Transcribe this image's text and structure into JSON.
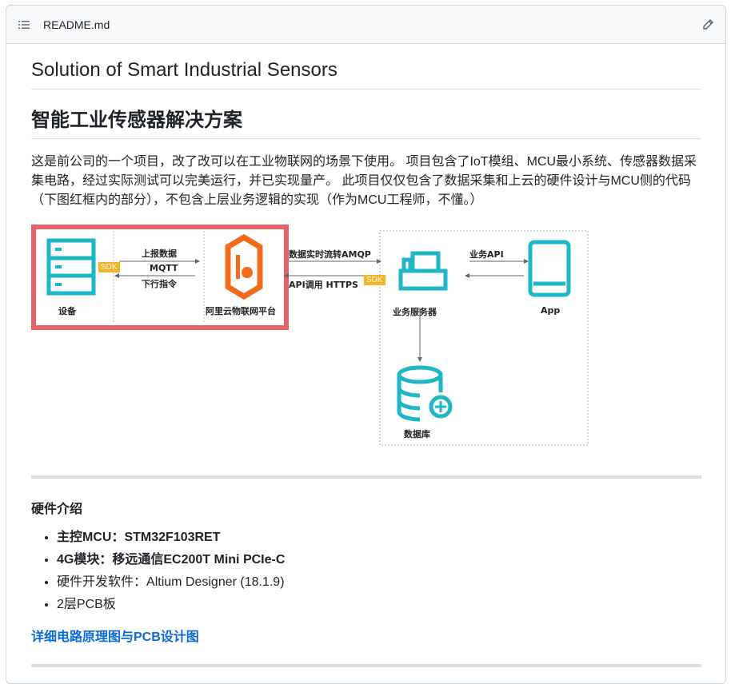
{
  "header": {
    "filename": "README.md",
    "list_icon": "list-icon",
    "edit_icon": "pencil-icon"
  },
  "title": "Solution of Smart Industrial Sensors",
  "heading_cn": "智能工业传感器解决方案",
  "description": "这是前公司的一个项目，改了改可以在工业物联网的场景下使用。 项目包含了IoT模组、MCU最小系统、传感器数据采集电路，经过实际测试可以完美运行，并已实现量产。 此项目仅仅包含了数据采集和上云的硬件设计与MCU侧的代码（下图红框内的部分），不包含上层业务逻辑的实现（作为MCU工程师，不懂。）",
  "diagram": {
    "device": "设备",
    "sdk": "SDK",
    "up": "上报数据",
    "mqtt": "MQTT",
    "down": "下行指令",
    "platform": "阿里云物联网平台",
    "amqp": "数据实时流转AMQP",
    "https": "API调用 HTTPS",
    "server": "业务服务器",
    "api": "业务API",
    "app": "App",
    "db": "数据库",
    "colors": {
      "teal": "#1eb7c6",
      "orange": "#f26b1d",
      "red": "#e8606a",
      "sdk": "#f5b324"
    }
  },
  "hardware": {
    "heading": "硬件介绍",
    "items": [
      {
        "label": "主控MCU：",
        "value": "STM32F103RET",
        "bold": true
      },
      {
        "label": "4G模块：",
        "value": "移远通信EC200T Mini PCIe-C",
        "bold": true
      },
      {
        "label": "硬件开发软件：",
        "value": "Altium Designer (18.1.9)",
        "bold": false
      },
      {
        "label": "",
        "value": "2层PCB板",
        "bold": false
      }
    ],
    "link": "详细电路原理图与PCB设计图"
  }
}
